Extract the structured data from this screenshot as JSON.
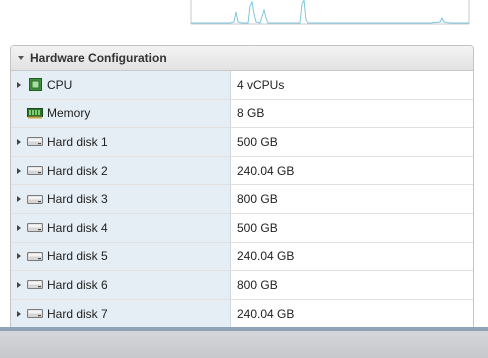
{
  "section": {
    "title": "Hardware Configuration"
  },
  "rows": [
    {
      "label": "CPU",
      "value": "4 vCPUs",
      "icon": "cpu-icon",
      "expandable": true
    },
    {
      "label": "Memory",
      "value": "8 GB",
      "icon": "memory-icon",
      "expandable": false
    },
    {
      "label": "Hard disk 1",
      "value": "500 GB",
      "icon": "hard-disk-icon",
      "expandable": true
    },
    {
      "label": "Hard disk 2",
      "value": "240.04 GB",
      "icon": "hard-disk-icon",
      "expandable": true
    },
    {
      "label": "Hard disk 3",
      "value": "800 GB",
      "icon": "hard-disk-icon",
      "expandable": true
    },
    {
      "label": "Hard disk 4",
      "value": "500 GB",
      "icon": "hard-disk-icon",
      "expandable": true
    },
    {
      "label": "Hard disk 5",
      "value": "240.04 GB",
      "icon": "hard-disk-icon",
      "expandable": true
    },
    {
      "label": "Hard disk 6",
      "value": "800 GB",
      "icon": "hard-disk-icon",
      "expandable": true
    },
    {
      "label": "Hard disk 7",
      "value": "240.04 GB",
      "icon": "hard-disk-icon",
      "expandable": true
    },
    {
      "label": "",
      "value": "",
      "icon": "hard-disk-icon",
      "expandable": true
    }
  ],
  "colors": {
    "name_column_bg": "#e5eef5",
    "sparkline": "#7fc6e0",
    "bottom_bar_accent": "#8fa3b8"
  }
}
